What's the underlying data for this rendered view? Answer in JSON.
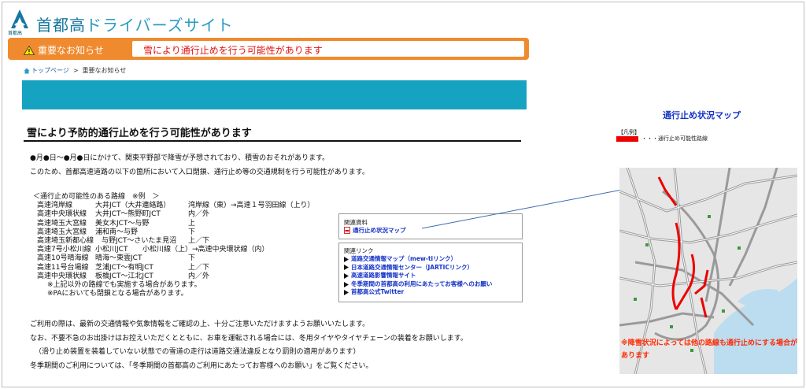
{
  "brand": {
    "title_main": "首都高",
    "title_sub": "ドライバーズサイト",
    "small_label": "首都高"
  },
  "notice": {
    "label": "重要なお知らせ",
    "message": "雪により通行止めを行う可能性があります"
  },
  "breadcrumb": {
    "home": "トップページ",
    "separator": ">",
    "current": "重要なお知らせ"
  },
  "article": {
    "title": "雪により予防的通行止めを行う可能性があります",
    "intro_lines": [
      "●月●日～●月●日にかけて、関東平野部で降雪が予想されており、積雪のおそれがあります。",
      "このため、首都高速道路の以下の箇所において入口閉鎖、通行止め等の交通規制を行う可能性があります。"
    ],
    "list_header": "＜通行止め可能性のある路線　※例　＞",
    "routes": [
      {
        "route": "高速湾岸線",
        "section": "大井JCT（大井連絡路）",
        "direction": "湾岸線（東）→高速１号羽田線（上り）"
      },
      {
        "route": "高速中央環状線",
        "section": "大井JCT～熊野町JCT",
        "direction": "内／外"
      },
      {
        "route": "高速埼玉大宮線",
        "section": "美女木JCT～与野",
        "direction": "上"
      },
      {
        "route": "高速埼玉大宮線",
        "section": "浦和南～与野",
        "direction": "下"
      },
      {
        "route": "高速埼玉新都心線",
        "section": "与野JCT～さいたま見沼",
        "direction": "上／下"
      },
      {
        "route": "高速7号小松川線",
        "section": "小松川JCT",
        "direction": "小松川線（上）→高速中央環状線（内）"
      },
      {
        "route": "高速10号晴海線",
        "section": "晴海～東雲JCT",
        "direction": "下"
      },
      {
        "route": "高速11号台場線",
        "section": "芝浦JCT～有明JCT",
        "direction": "上／下"
      },
      {
        "route": "高速中央環状線",
        "section": "板橋JCT～江北JCT",
        "direction": "内／外"
      }
    ],
    "notes": [
      "※上記以外の路線でも実施する場合があります。",
      "※PAにおいても閉鎖となる場合があります。"
    ],
    "closing_lines": [
      "ご利用の際は、最新の交通情報や気象情報をご確認の上、十分ご注意いただけますようお願いいたします。",
      "なお、不要不急のお出掛けはお控えいただくとともに、お車を運転される場合には、冬用タイヤやタイヤチェーンの装着をお願いします。",
      "（滑り止め装置を装着していない状態での雪道の走行は道路交通法違反となり罰則の適用があります）",
      "冬季期間のご利用については、「冬季期間の首都高のご利用にあたってお客様へのお願い」をご覧ください。"
    ]
  },
  "related_docs": {
    "label": "関連資料",
    "link": "通行止め状況マップ"
  },
  "related_links": {
    "label": "関連リンク",
    "items": [
      "道路交通情報マップ（mew-tiリンク）",
      "日本道路交通情報センター（JARTICリンク）",
      "高速道路影響情報サイト",
      "冬季期間の首都高の利用にあたってお客様へのお願い",
      "首都高公式Twitter"
    ]
  },
  "map_panel": {
    "title": "通行止め状況マップ",
    "legend_label": "【凡例】",
    "legend_text": "・・・通行止め可能性路線",
    "warning": "※降雪状況によっては他の路線も通行止めにする場合があります"
  },
  "colors": {
    "accent_orange": "#f08a2e",
    "teal": "#16a2c1",
    "alert_red": "#e51010",
    "link_blue": "#1533c8"
  }
}
